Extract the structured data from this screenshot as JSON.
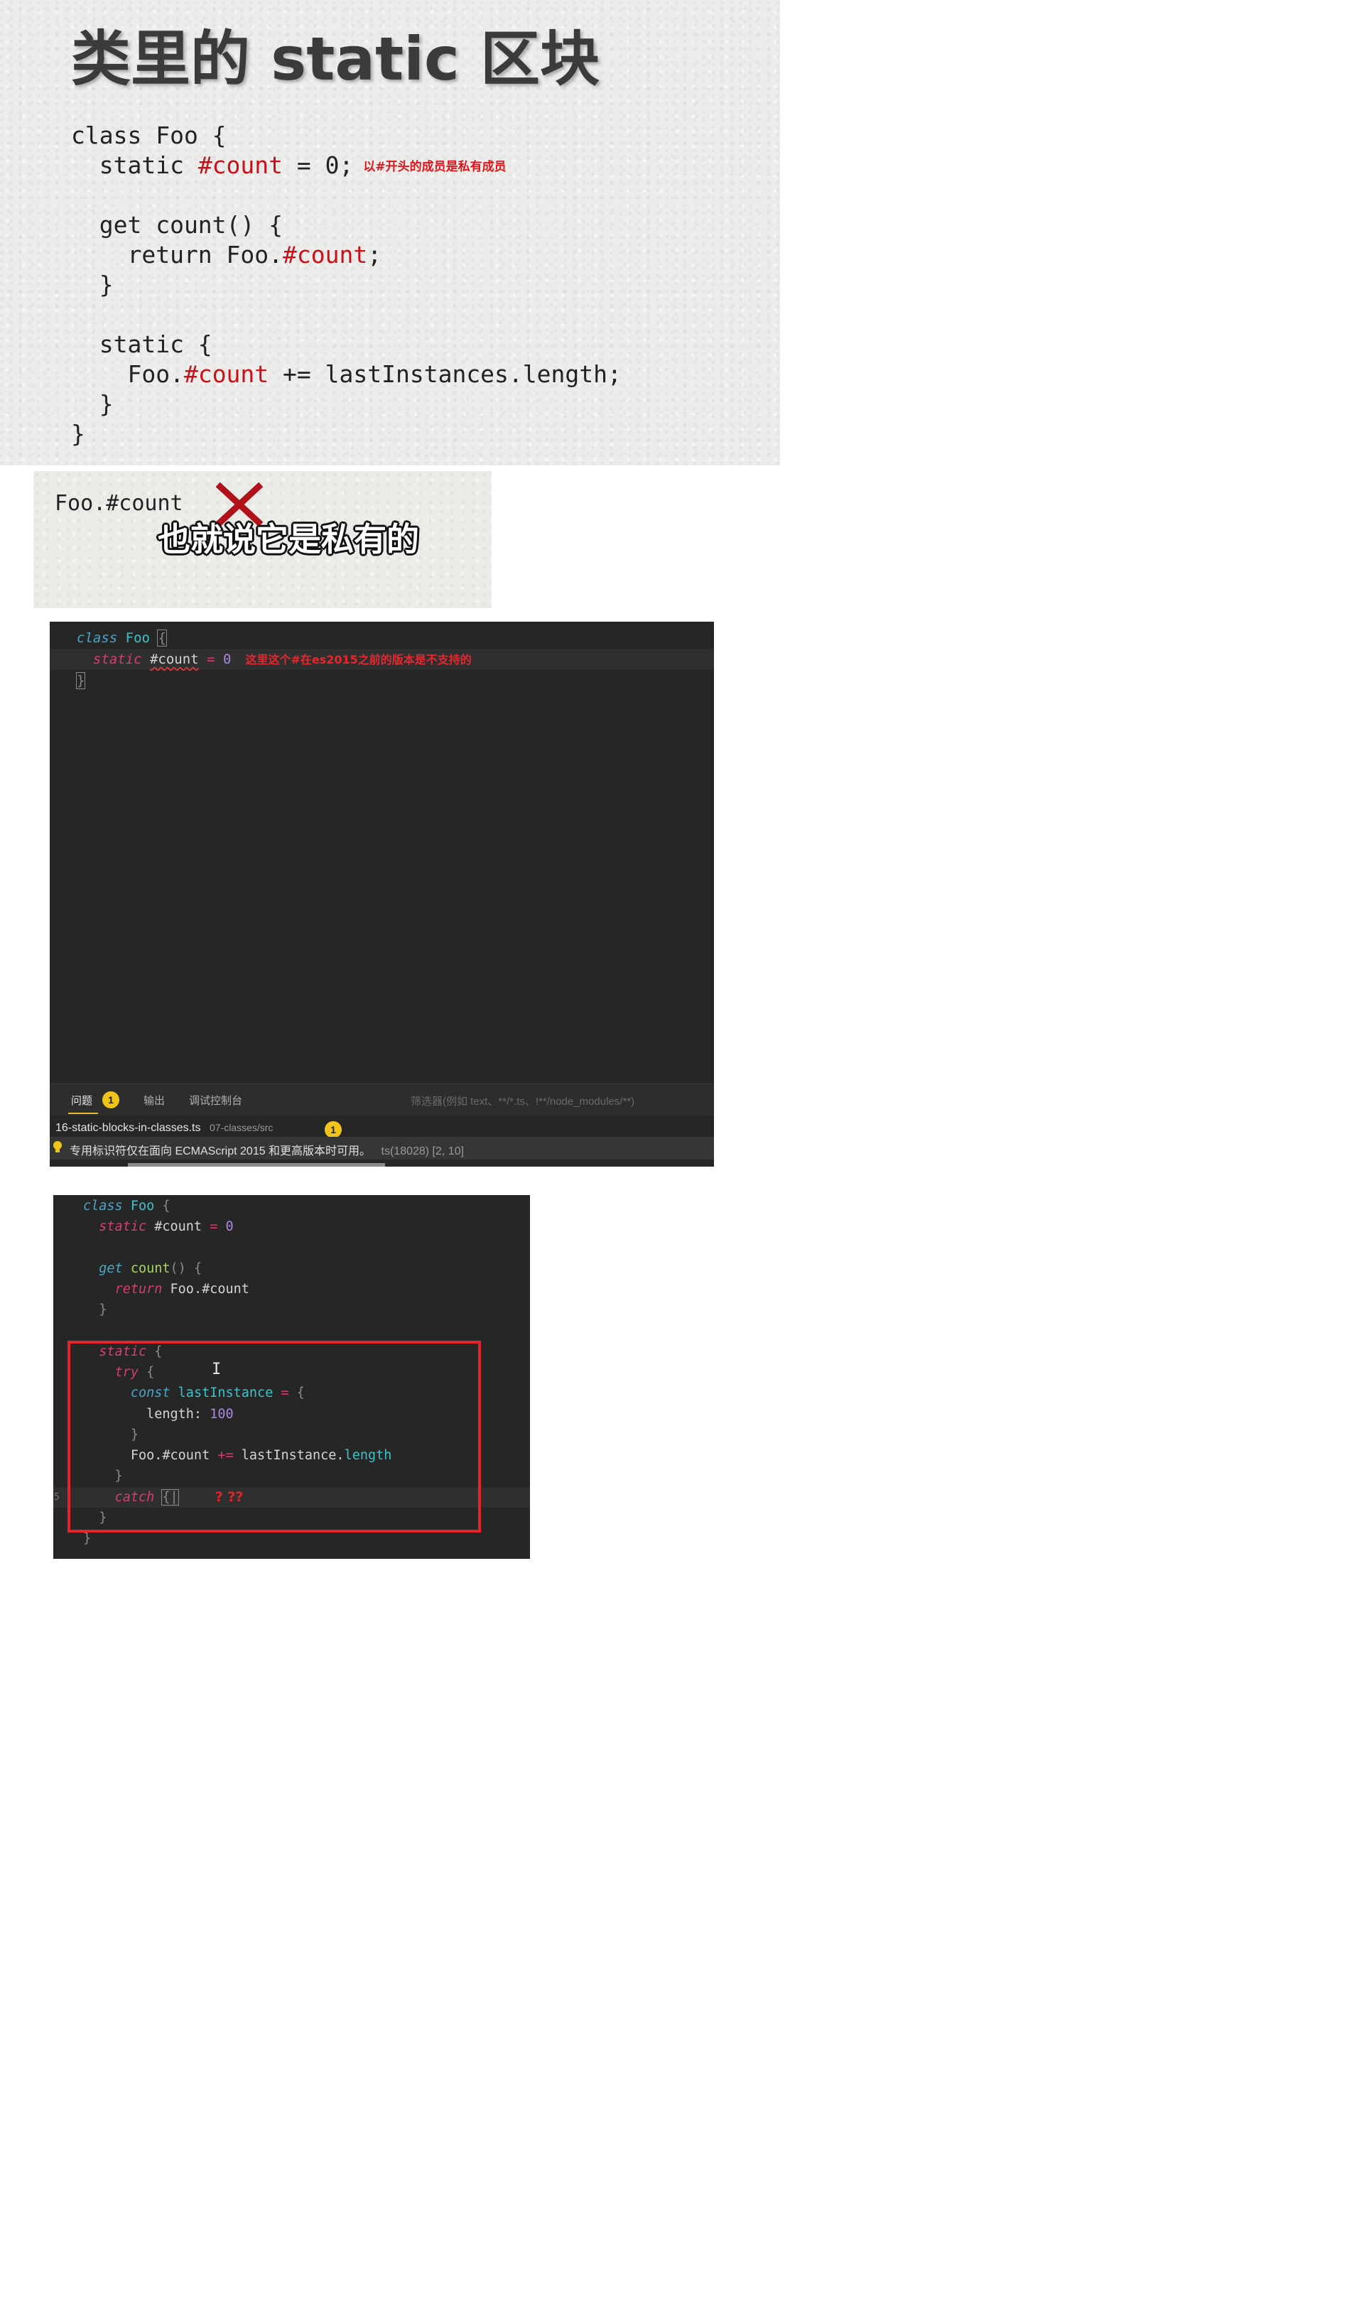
{
  "slide": {
    "title": "类里的 static 区块",
    "code": [
      [
        {
          "t": "class Foo {"
        }
      ],
      [
        {
          "t": "  static "
        },
        {
          "t": "#count",
          "c": "red"
        },
        {
          "t": " = 0;"
        }
      ],
      [
        {
          "t": ""
        }
      ],
      [
        {
          "t": "  get count() {"
        }
      ],
      [
        {
          "t": "    return Foo."
        },
        {
          "t": "#count",
          "c": "red"
        },
        {
          "t": ";"
        }
      ],
      [
        {
          "t": "  }"
        }
      ],
      [
        {
          "t": ""
        }
      ],
      [
        {
          "t": "  static {"
        }
      ],
      [
        {
          "t": "    Foo."
        },
        {
          "t": "#count",
          "c": "red"
        },
        {
          "t": " += lastInstances.length;"
        }
      ],
      [
        {
          "t": "  }"
        }
      ],
      [
        {
          "t": "}"
        }
      ]
    ],
    "note": "以#开头的成员是私有成员"
  },
  "snippet": {
    "code": "Foo.#count",
    "mark": "cross-mark-icon",
    "subtitle": "也就说它是私有的"
  },
  "editor": {
    "code": [
      [
        {
          "t": "class",
          "c": "kw-i"
        },
        {
          "t": " "
        },
        {
          "t": "Foo",
          "c": "cls"
        },
        {
          "t": " "
        },
        {
          "t": "{",
          "c": "brace bracebox"
        }
      ],
      [
        {
          "t": "  "
        },
        {
          "t": "static",
          "c": "kw-r"
        },
        {
          "t": " "
        },
        {
          "t": "#count",
          "c": "plain squig"
        },
        {
          "t": " "
        },
        {
          "t": "=",
          "c": "op"
        },
        {
          "t": " "
        },
        {
          "t": "0",
          "c": "num"
        }
      ],
      [
        {
          "t": "}",
          "c": "brace bracebox"
        }
      ]
    ],
    "annotation": "这里这个#在es2015之前的版本是不支持的",
    "tabs": [
      {
        "label": "问题",
        "active": true,
        "badge": "1"
      },
      {
        "label": "输出",
        "active": false
      },
      {
        "label": "调试控制台",
        "active": false
      }
    ],
    "filter_placeholder": "筛选器(例如 text、**/*.ts、!**/node_modules/**)",
    "problem_file": "16-static-blocks-in-classes.ts",
    "problem_path": "07-classes/src",
    "problem_count": "1",
    "problem_message": "专用标识符仅在面向 ECMAScript 2015 和更高版本时可用。",
    "problem_code": "ts(18028)  [2, 10]",
    "colors": {
      "background": "#262626",
      "warning": "#f0c419",
      "annotation": "#e8262e"
    }
  },
  "editor2": {
    "code": [
      [
        {
          "t": "class",
          "c": "kw-i"
        },
        {
          "t": " "
        },
        {
          "t": "Foo",
          "c": "cls"
        },
        {
          "t": " {",
          "c": "brace"
        }
      ],
      [
        {
          "t": "  "
        },
        {
          "t": "static",
          "c": "kw-r"
        },
        {
          "t": " #count",
          "c": "plain"
        },
        {
          "t": " = ",
          "c": "op"
        },
        {
          "t": "0",
          "c": "num"
        }
      ],
      [
        {
          "t": ""
        }
      ],
      [
        {
          "t": "  "
        },
        {
          "t": "get",
          "c": "kw-i"
        },
        {
          "t": " "
        },
        {
          "t": "count",
          "c": "fn"
        },
        {
          "t": "() {",
          "c": "brace"
        }
      ],
      [
        {
          "t": "    "
        },
        {
          "t": "return",
          "c": "kw-r"
        },
        {
          "t": " Foo.#count",
          "c": "plain"
        }
      ],
      [
        {
          "t": "  }",
          "c": "brace"
        }
      ],
      [
        {
          "t": ""
        }
      ],
      [
        {
          "t": "  "
        },
        {
          "t": "static",
          "c": "kw-r"
        },
        {
          "t": " {",
          "c": "brace"
        }
      ],
      [
        {
          "t": "    "
        },
        {
          "t": "try",
          "c": "kw-r"
        },
        {
          "t": " {",
          "c": "brace"
        }
      ],
      [
        {
          "t": "      "
        },
        {
          "t": "const",
          "c": "kw-i"
        },
        {
          "t": " "
        },
        {
          "t": "lastInstance",
          "c": "prop"
        },
        {
          "t": " = ",
          "c": "op"
        },
        {
          "t": "{",
          "c": "brace"
        }
      ],
      [
        {
          "t": "        length: ",
          "c": "plain"
        },
        {
          "t": "100",
          "c": "num"
        }
      ],
      [
        {
          "t": "      }",
          "c": "brace"
        }
      ],
      [
        {
          "t": "      Foo.#count ",
          "c": "plain"
        },
        {
          "t": "+=",
          "c": "op"
        },
        {
          "t": " lastInstance.",
          "c": "plain"
        },
        {
          "t": "length",
          "c": "prop"
        }
      ],
      [
        {
          "t": "    }",
          "c": "brace"
        }
      ],
      [
        {
          "t": "    "
        },
        {
          "t": "catch",
          "c": "kw-r"
        },
        {
          "t": " "
        },
        {
          "t": "{|",
          "c": "brace bracebox"
        }
      ],
      [
        {
          "t": "  }",
          "c": "brace"
        }
      ],
      [
        {
          "t": "}",
          "c": "brace"
        }
      ]
    ],
    "question_marks": "? ??",
    "highlight_color": "#e3252b"
  }
}
